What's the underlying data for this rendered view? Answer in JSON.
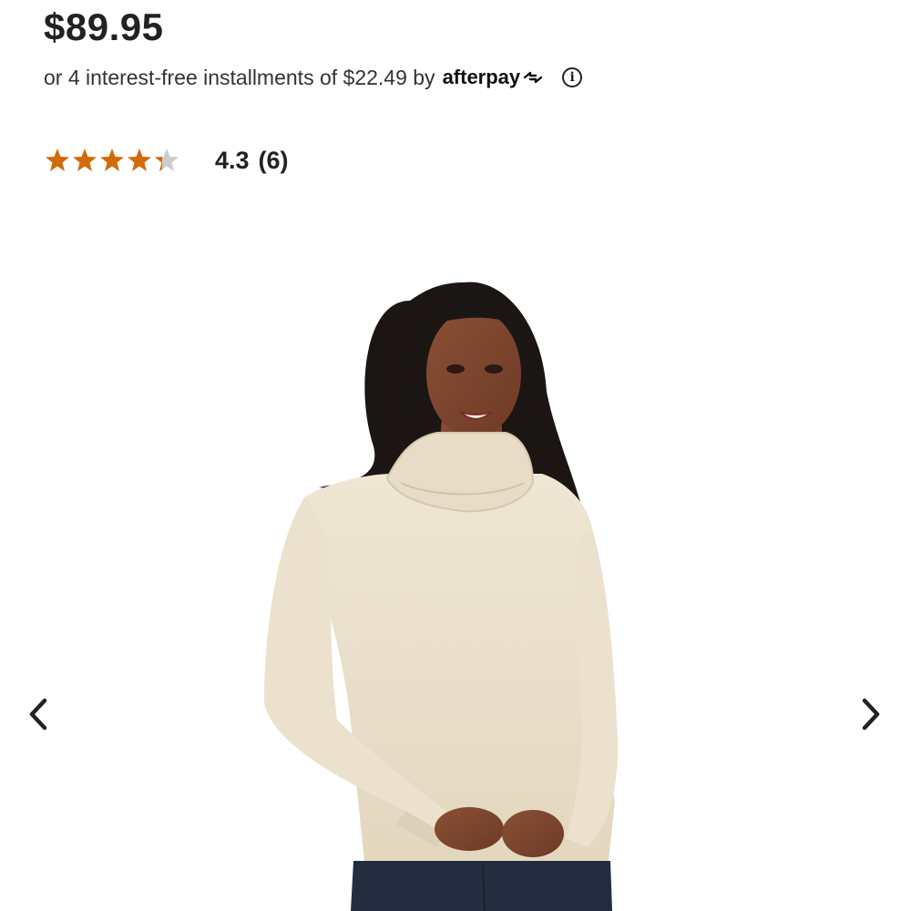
{
  "product": {
    "price": "$89.95",
    "installments_text": "or 4 interest-free installments of $22.49 by",
    "installments_provider": "afterpay",
    "info_icon": "info-circle-icon",
    "rating": {
      "stars_value": 4.3,
      "stars_max": 5,
      "value_label": "4.3",
      "count_label": "(6)",
      "star_color": "#d4690a",
      "star_empty_color": "#cccccc"
    }
  },
  "carousel": {
    "prev_icon": "chevron-left-icon",
    "next_icon": "chevron-right-icon"
  },
  "image": {
    "alt": "woman-wearing-cream-turtleneck-sweater"
  }
}
